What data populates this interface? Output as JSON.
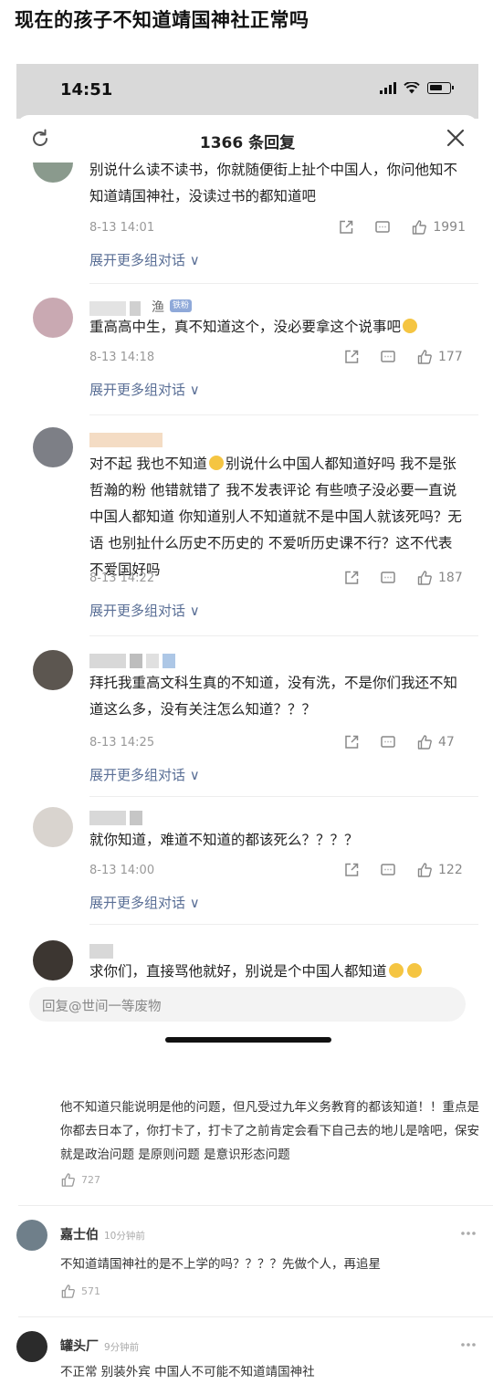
{
  "post": {
    "title": "现在的孩子不知道靖国神社正常吗"
  },
  "status_bar": {
    "time": "14:51"
  },
  "sheet": {
    "title": "1366 条回复"
  },
  "comments": [
    {
      "text": "别说什么读不读书，你就随便街上扯个中国人，你问他知不知道靖国神社，没读过书的都知道吧",
      "time": "8-13 14:01",
      "likes": "1991",
      "expand": "展开更多组对话 ∨"
    },
    {
      "name": "渔",
      "badge": "铁粉",
      "text_before": "重高高中生，真不知道这个，没必要拿这个说事吧",
      "emoji": "smile-emoji",
      "time": "8-13 14:18",
      "likes": "177",
      "expand": "展开更多组对话 ∨"
    },
    {
      "text_before": "对不起 我也不知道",
      "emoji": "smile-emoji",
      "text_after": "别说什么中国人都知道好吗 我不是张哲瀚的粉 他错就错了 我不发表评论 有些喷子没必要一直说中国人都知道 你知道别人不知道就不是中国人就该死吗？无语 也别扯什么历史不历史的 不爱听历史课不行？这不代表不爱国好吗",
      "time": "8-13 14:22",
      "likes": "187",
      "expand": "展开更多组对话 ∨"
    },
    {
      "text": "拜托我重高文科生真的不知道，没有洗，不是你们我还不知道这么多，没有关注怎么知道？？？",
      "time": "8-13 14:25",
      "likes": "47",
      "expand": "展开更多组对话 ∨"
    },
    {
      "text": "就你知道，难道不知道的都该死么？？？？",
      "time": "8-13 14:00",
      "likes": "122",
      "expand": "展开更多组对话 ∨"
    },
    {
      "text": "求你们，直接骂他就好，别说是个中国人都知道",
      "emoji": "crying-emoji"
    }
  ],
  "reply_box": {
    "placeholder": "回复@世间一等废物"
  },
  "lower_comments": [
    {
      "text": "他不知道只能说明是他的问题，但凡受过九年义务教育的都该知道！！重点是你都去日本了，你打卡了，打卡了之前肯定会看下自己去的地儿是啥吧，保安就是政治问题 是原则问题 是意识形态问题",
      "likes": "727"
    },
    {
      "name": "嘉士伯",
      "ago": "10分钟前",
      "text": "不知道靖国神社的是不上学的吗？？？？先做个人，再追星",
      "likes": "571"
    },
    {
      "name": "罐头厂",
      "ago": "9分钟前",
      "text": "不正常  别装外宾  中国人不可能不知道靖国神社"
    }
  ],
  "colors": {
    "link": "#5a6f96",
    "badge": "#8fa9d9",
    "status_bar": "#d9d9d9",
    "emoji": "#f5c542"
  }
}
